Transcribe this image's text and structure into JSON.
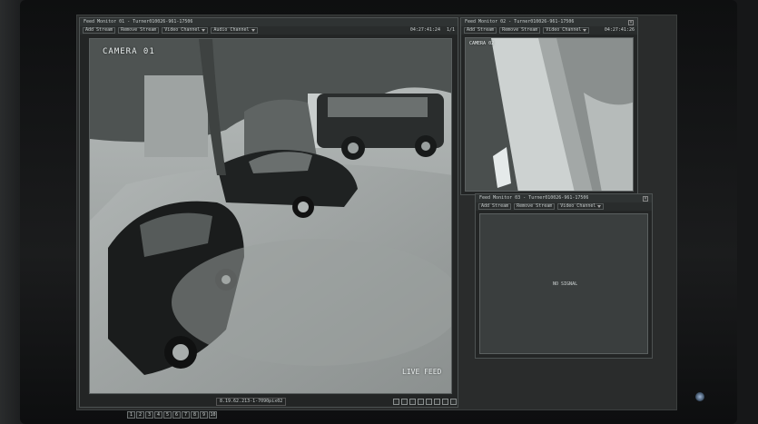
{
  "main_window": {
    "title": "Feed Monitor 01 - Turner010026-961-17506",
    "toolbar": {
      "add_stream": "Add Stream",
      "remove_stream": "Remove Stream",
      "video_channel": "Video Channel",
      "audio_channel": "Audio Channel"
    },
    "time": "04:27:41:24",
    "page": "1/1",
    "camera_label": "CAMERA 01",
    "live_label": "LIVE FEED",
    "status_text": "8.19.62.213-1-7090pix02"
  },
  "top_right_window": {
    "title": "Feed Monitor 02 - Turner010026-961-17506",
    "toolbar": {
      "add_stream": "Add Stream",
      "remove_stream": "Remove Stream",
      "video_channel": "Video Channel"
    },
    "time": "04:27:41:26",
    "camera_label": "CAMERA 02"
  },
  "bottom_right_window": {
    "title": "Feed Monitor 03 - Turner010026-961-17506",
    "toolbar": {
      "add_stream": "Add Stream",
      "remove_stream": "Remove Stream",
      "video_channel": "Video Channel"
    },
    "no_signal": "NO SIGNAL"
  },
  "pager": [
    "1",
    "2",
    "3",
    "4",
    "5",
    "6",
    "7",
    "8",
    "9",
    "10"
  ],
  "icons": {
    "close": "close-icon",
    "dropdown": "chevron-down-icon",
    "power": "power-led-icon"
  }
}
